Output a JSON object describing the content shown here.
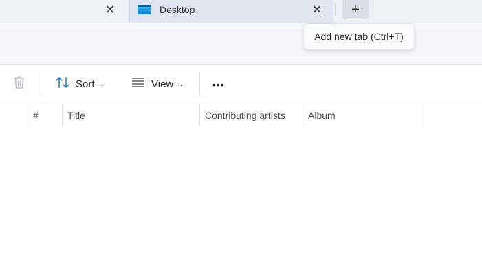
{
  "tabs": [
    {
      "title": "",
      "close": "✕"
    },
    {
      "title": "Desktop",
      "close": "✕",
      "icon": "desktop-icon",
      "icon_color": "#1aa0e0"
    }
  ],
  "new_tab": {
    "glyph": "+"
  },
  "tooltip": {
    "text": "Add new tab (Ctrl+T)"
  },
  "toolbar": {
    "delete_icon": "trash-icon",
    "sort_label": "Sort",
    "view_label": "View",
    "more_label": "•••",
    "chevron": "⌄"
  },
  "columns": [
    "#",
    "Title",
    "Contributing artists",
    "Album"
  ],
  "colors": {
    "tabstrip": "#eef1f6",
    "active_tab": "#dfe6f1",
    "accent": "#1a78c2"
  }
}
